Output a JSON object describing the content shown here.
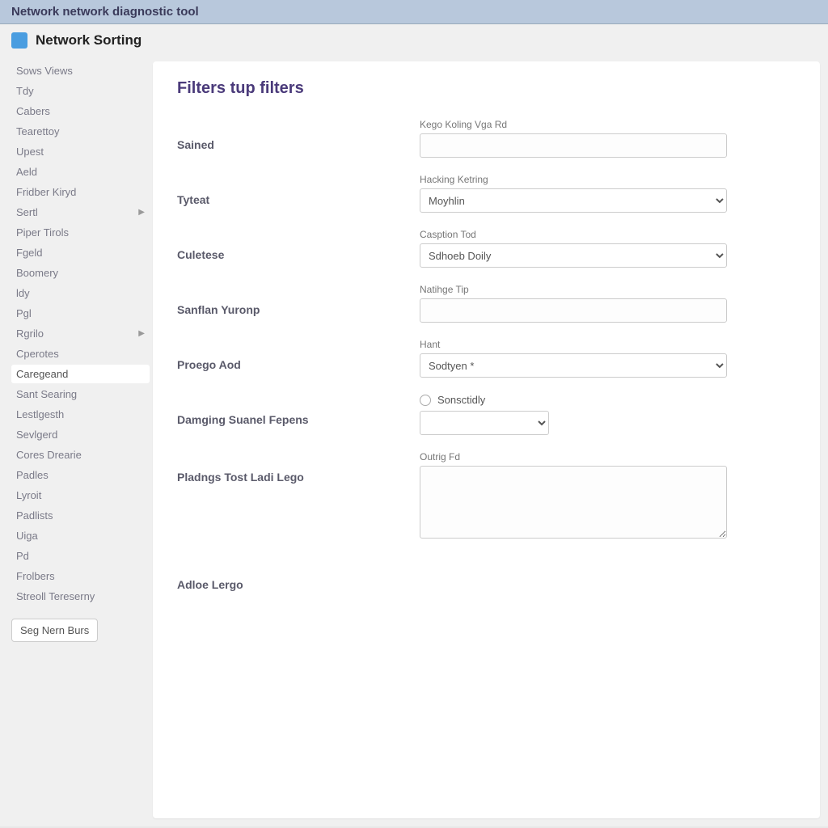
{
  "window": {
    "title": "Network network diagnostic tool"
  },
  "header": {
    "title": "Network Sorting"
  },
  "sidebar": {
    "items": [
      {
        "label": "Sows Views",
        "chev": false,
        "active": false
      },
      {
        "label": "Tdy",
        "chev": false,
        "active": false
      },
      {
        "label": "Cabers",
        "chev": false,
        "active": false
      },
      {
        "label": "Tearettoy",
        "chev": false,
        "active": false
      },
      {
        "label": "Upest",
        "chev": false,
        "active": false
      },
      {
        "label": "Aeld",
        "chev": false,
        "active": false
      },
      {
        "label": "Fridber Kiryd",
        "chev": false,
        "active": false
      },
      {
        "label": "Sertl",
        "chev": true,
        "active": false
      },
      {
        "label": "Piper Tirols",
        "chev": false,
        "active": false
      },
      {
        "label": "Fgeld",
        "chev": false,
        "active": false
      },
      {
        "label": "Boomery",
        "chev": false,
        "active": false
      },
      {
        "label": "ldy",
        "chev": false,
        "active": false
      },
      {
        "label": "Pgl",
        "chev": false,
        "active": false
      },
      {
        "label": "Rgrilo",
        "chev": true,
        "active": false
      },
      {
        "label": "Cperotes",
        "chev": false,
        "active": false
      },
      {
        "label": "Caregeand",
        "chev": false,
        "active": true
      },
      {
        "label": "Sant Searing",
        "chev": false,
        "active": false
      },
      {
        "label": "Lestlgesth",
        "chev": false,
        "active": false
      },
      {
        "label": "Sevlgerd",
        "chev": false,
        "active": false
      },
      {
        "label": "Cores Drearie",
        "chev": false,
        "active": false
      },
      {
        "label": "Padles",
        "chev": false,
        "active": false
      },
      {
        "label": "Lyroit",
        "chev": false,
        "active": false
      },
      {
        "label": "Padlists",
        "chev": false,
        "active": false
      },
      {
        "label": "Uiga",
        "chev": false,
        "active": false
      },
      {
        "label": "Pd",
        "chev": false,
        "active": false
      },
      {
        "label": "Frolbers",
        "chev": false,
        "active": false
      },
      {
        "label": "Streoll Tereserny",
        "chev": false,
        "active": false
      }
    ],
    "footer_button": "Seg Nern Burs"
  },
  "main": {
    "heading": "Filters tup filters",
    "rows": [
      {
        "label": "Sained",
        "field_label": "Kego Koling Vga Rd",
        "type": "text",
        "value": ""
      },
      {
        "label": "Tyteat",
        "field_label": "Hacking Ketring",
        "type": "select",
        "value": "Moyhlin"
      },
      {
        "label": "Culetese",
        "field_label": "Casption Tod",
        "type": "select",
        "value": "Sdhoeb Doily"
      },
      {
        "label": "Sanflan Yuronp",
        "field_label": "Natihge Tip",
        "type": "text",
        "value": ""
      },
      {
        "label": "Proego Aod",
        "field_label": "Hant",
        "type": "select",
        "value": "Sodtyen *"
      },
      {
        "label": "Damging Suanel Fepens",
        "field_label": "",
        "type": "radio",
        "radio_label": "Sonsctidly",
        "value": ""
      },
      {
        "label": "Pladngs Tost Ladi Lego",
        "field_label": "Outrig Fd",
        "type": "textarea",
        "value": ""
      },
      {
        "label": "Adloe Lergo",
        "field_label": "",
        "type": "none",
        "value": ""
      }
    ]
  }
}
